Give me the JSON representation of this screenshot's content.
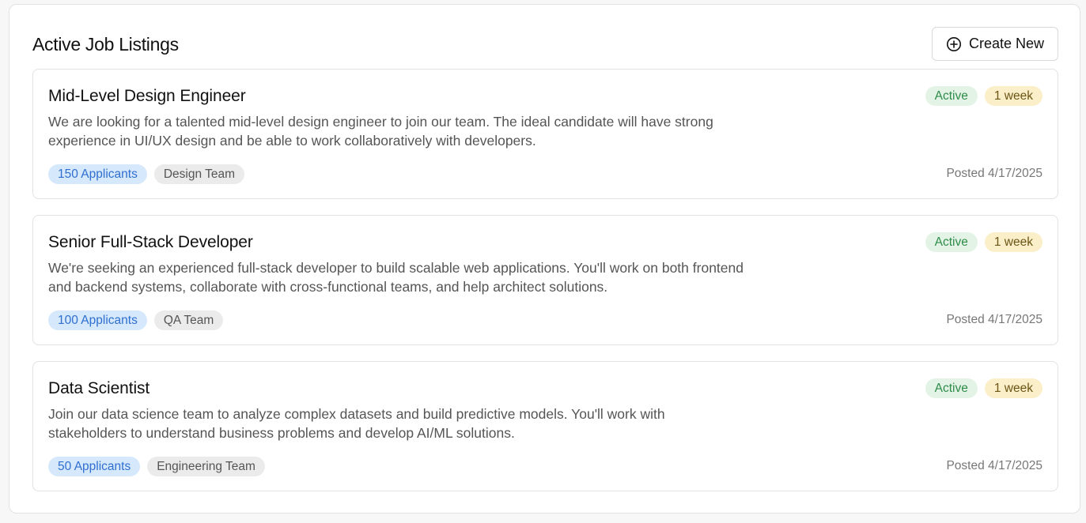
{
  "header": {
    "title": "Active Job Listings",
    "create_label": "Create New",
    "create_icon": "plus-circle-icon"
  },
  "jobs": [
    {
      "title": "Mid-Level Design Engineer",
      "description": "We are looking for a talented mid-level design engineer to join our team. The ideal candidate will have strong experience in UI/UX design and be able to work collaboratively with developers.",
      "status": "Active",
      "duration": "1 week",
      "applicants": "150 Applicants",
      "team": "Design Team",
      "posted": "Posted 4/17/2025"
    },
    {
      "title": "Senior Full-Stack Developer",
      "description": "We're seeking an experienced full-stack developer to build scalable web applications. You'll work on both frontend and backend systems, collaborate with cross-functional teams, and help architect solutions.",
      "status": "Active",
      "duration": "1 week",
      "applicants": "100 Applicants",
      "team": "QA Team",
      "posted": "Posted 4/17/2025"
    },
    {
      "title": "Data Scientist",
      "description": "Join our data science team to analyze complex datasets and build predictive models. You'll work with stakeholders to understand business problems and develop AI/ML solutions.",
      "status": "Active",
      "duration": "1 week",
      "applicants": "50 Applicants",
      "team": "Engineering Team",
      "posted": "Posted 4/17/2025"
    }
  ],
  "colors": {
    "status_active_bg": "#e3f4e6",
    "status_active_text": "#2e8b4a",
    "duration_bg": "#fbefc9",
    "applicants_bg": "#d6e8fb",
    "applicants_text": "#2f6fd0",
    "team_bg": "#ebebeb"
  }
}
